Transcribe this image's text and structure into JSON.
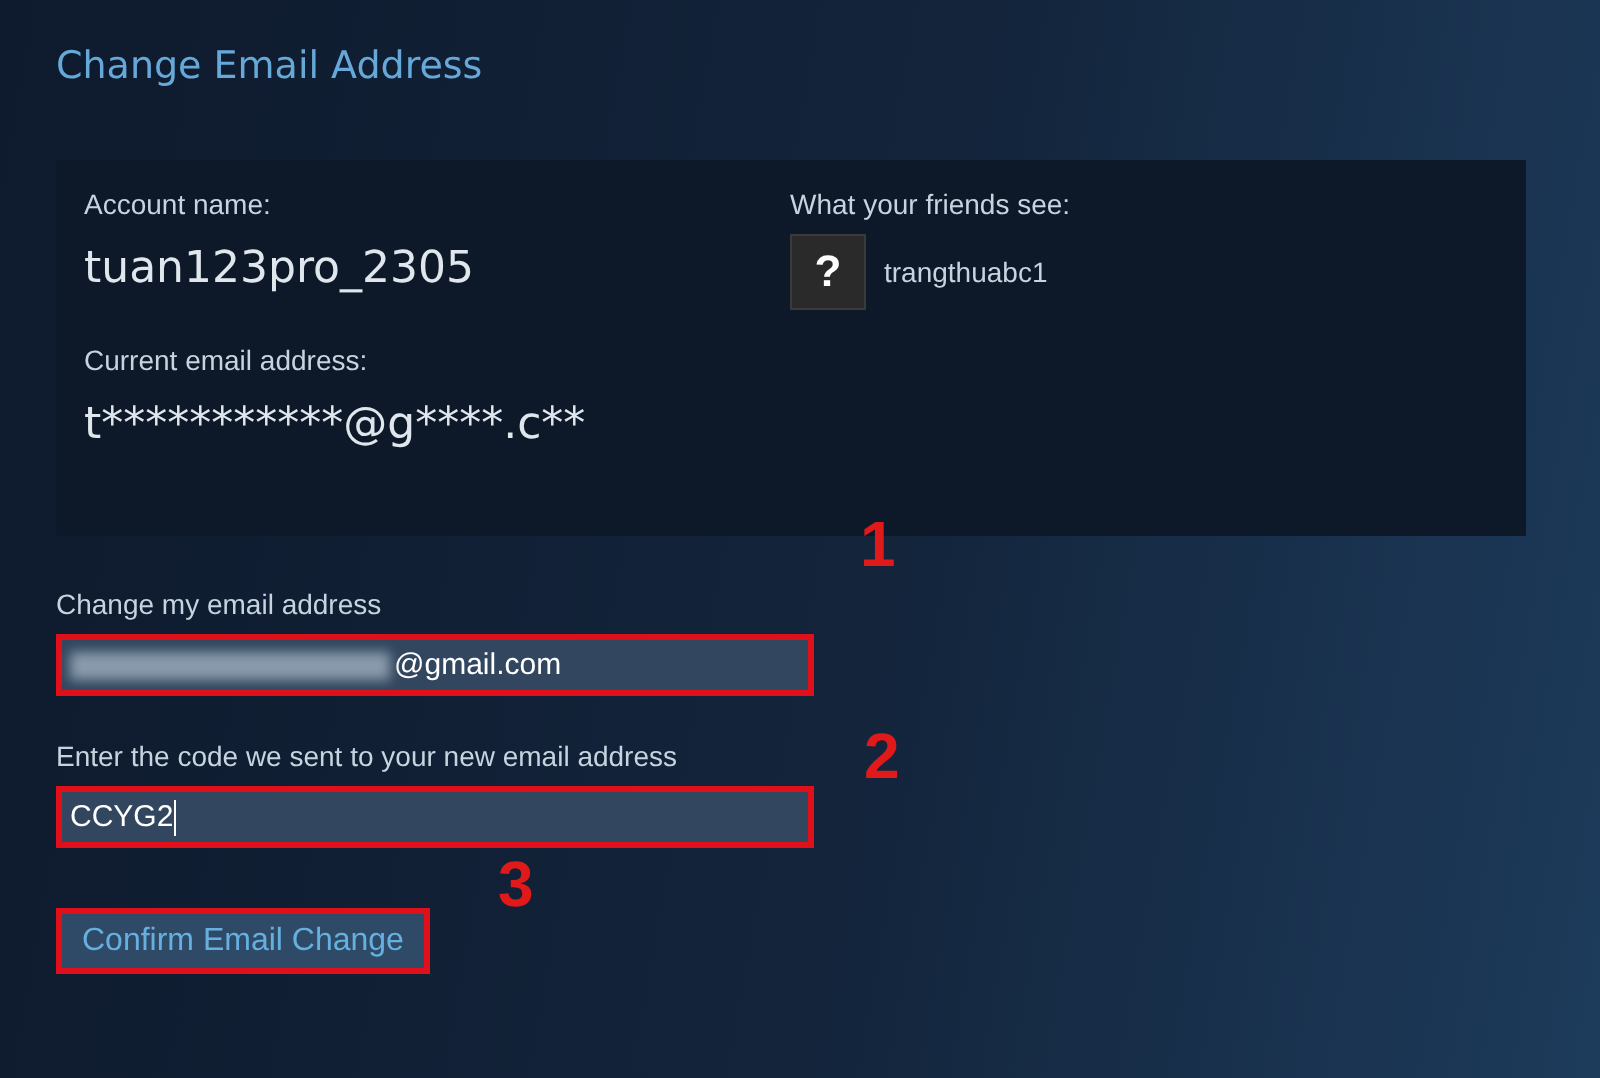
{
  "title": "Change Email Address",
  "account": {
    "name_label": "Account name:",
    "name": "tuan123pro_2305",
    "friends_label": "What your friends see:",
    "avatar": "?",
    "friend_name": "trangthuabc1",
    "email_label": "Current email address:",
    "email": "t***********@g****.c**"
  },
  "fields": [
    {
      "label": "Change my email address",
      "value": "@gmail.com",
      "redacted": true,
      "highlighted": true,
      "step": "1",
      "cursor": false
    },
    {
      "label": "Enter the code we sent to your new email address",
      "value": "CCYG2",
      "redacted": false,
      "highlighted": true,
      "step": "2",
      "cursor": true
    }
  ],
  "button": {
    "label": "Confirm Email Change",
    "highlighted": true,
    "step": "3"
  }
}
